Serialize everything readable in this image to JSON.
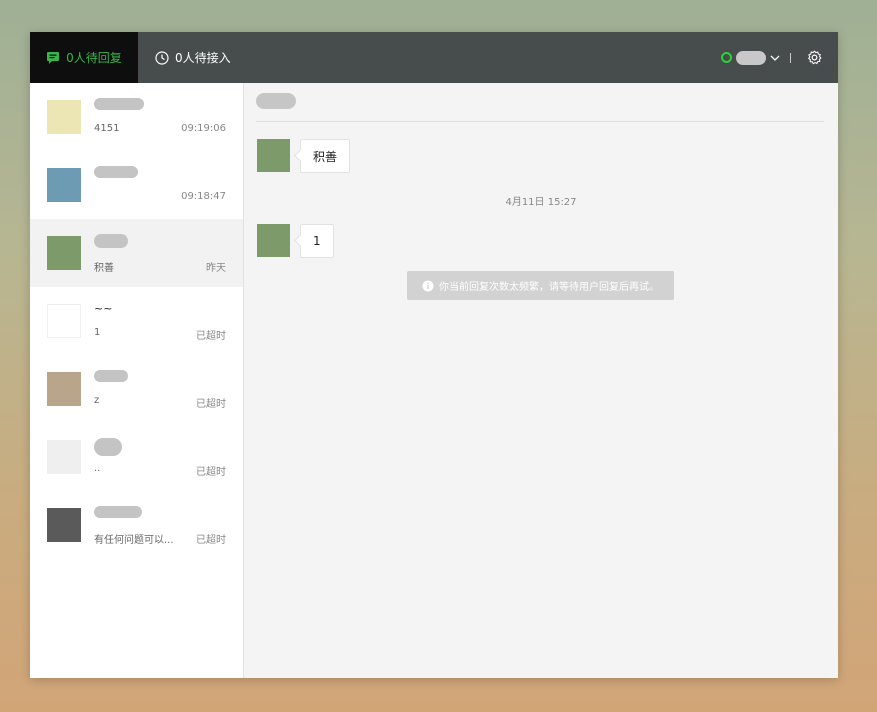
{
  "tabs": {
    "pending_reply": "0人待回复",
    "pending_accept": "0人待接入"
  },
  "conversations": [
    {
      "name": "",
      "message": "4151",
      "time": "09:19:06"
    },
    {
      "name": "",
      "message": "",
      "time": "09:18:47"
    },
    {
      "name": "",
      "message": "积善",
      "time": "昨天"
    },
    {
      "name": "~~",
      "message": "1",
      "time": "已超时"
    },
    {
      "name": "",
      "message": "z",
      "time": "已超时"
    },
    {
      "name": "",
      "message": "..",
      "time": "已超时"
    },
    {
      "name": "",
      "message": "有任何问题可以...",
      "time": "已超时"
    }
  ],
  "chat": {
    "messages": [
      {
        "text": "积善"
      },
      {
        "text": "1"
      }
    ],
    "timestamp": "4月11日 15:27",
    "notice": "你当前回复次数太频繁，请等待用户回复后再试。"
  },
  "colors": {
    "accent": "#39b54a",
    "topbar": "#474c4c",
    "status_online": "#2fcf3a"
  }
}
